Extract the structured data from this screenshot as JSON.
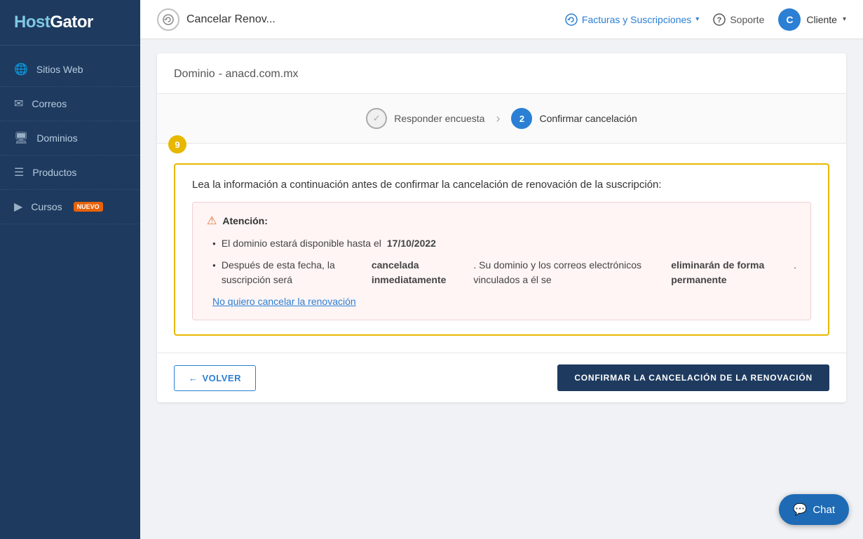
{
  "sidebar": {
    "logo": "HostGator",
    "items": [
      {
        "id": "sitios-web",
        "label": "Sitios Web",
        "icon": "🌐"
      },
      {
        "id": "correos",
        "label": "Correos",
        "icon": "✉"
      },
      {
        "id": "dominios",
        "label": "Dominios",
        "icon": "🖥"
      },
      {
        "id": "productos",
        "label": "Productos",
        "icon": "☰"
      },
      {
        "id": "cursos",
        "label": "Cursos",
        "icon": "▶",
        "badge": "NUEVO"
      }
    ]
  },
  "topbar": {
    "title": "Cancelar Renov...",
    "icon_label": "renew-icon",
    "facturacion_label": "Facturas y Suscripciones",
    "soporte_label": "Soporte",
    "user_initial": "C",
    "user_label": "Cliente"
  },
  "page": {
    "domain_label": "Dominio",
    "domain_name": "anacd.com.mx",
    "steps": [
      {
        "id": "step1",
        "number": "✓",
        "label": "Responder encuesta",
        "state": "completed"
      },
      {
        "id": "step2",
        "number": "2",
        "label": "Confirmar cancelación",
        "state": "active"
      }
    ],
    "warning_number": "9",
    "info_title": "Lea la información a continuación antes de confirmar la cancelación de renovación de la suscripción:",
    "attention_title": "Atención:",
    "bullets": [
      "El dominio estará disponible hasta el 17/10/2022",
      "Después de esta fecha, la suscripción será cancelada inmediatamente. Su dominio y los correos electrónicos vinculados a él se eliminarán de forma permanente."
    ],
    "bullet_bold_1": "17/10/2022",
    "bullet_bold_2_1": "cancelada inmediatamente",
    "bullet_bold_2_2": "eliminarán de forma permanente",
    "no_cancel_link": "No quiero cancelar la renovación",
    "btn_back": "VOLVER",
    "btn_confirm": "CONFIRMAR LA CANCELACIÓN DE LA RENOVACIÓN",
    "chat_label": "Chat"
  }
}
